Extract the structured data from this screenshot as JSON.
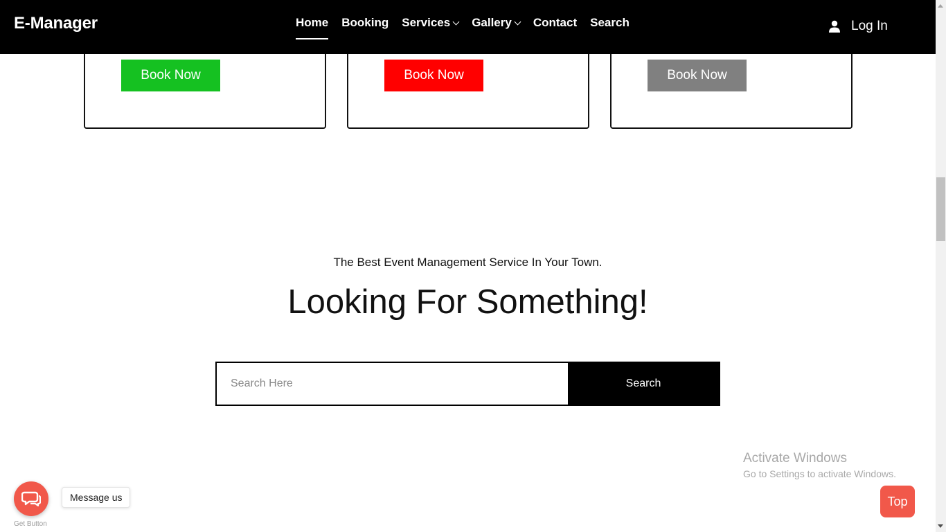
{
  "header": {
    "brand": "E-Manager",
    "nav": [
      {
        "label": "Home",
        "active": true
      },
      {
        "label": "Booking"
      },
      {
        "label": "Services",
        "dropdown": true
      },
      {
        "label": "Gallery",
        "dropdown": true
      },
      {
        "label": "Contact"
      },
      {
        "label": "Search"
      }
    ],
    "login": {
      "label": "Log In",
      "icon": "user-icon"
    }
  },
  "cards": [
    {
      "button_label": "Book Now",
      "button_color": "#15c121"
    },
    {
      "button_label": "Book Now",
      "button_color": "#ff0000"
    },
    {
      "button_label": "Book Now",
      "button_color": "#808080"
    }
  ],
  "hero": {
    "tagline": "The Best Event Management Service In Your Town.",
    "headline": "Looking For Something!"
  },
  "search": {
    "placeholder": "Search Here",
    "value": "",
    "button_label": "Search"
  },
  "watermark": {
    "title": "Activate Windows",
    "subtitle": "Go to Settings to activate Windows."
  },
  "chat_widget": {
    "icon": "chat-bubbles-icon",
    "label": "Message us",
    "footer": "Get Button",
    "color": "#f1584a"
  },
  "top_button": {
    "label": "Top",
    "color": "#f1584a"
  }
}
